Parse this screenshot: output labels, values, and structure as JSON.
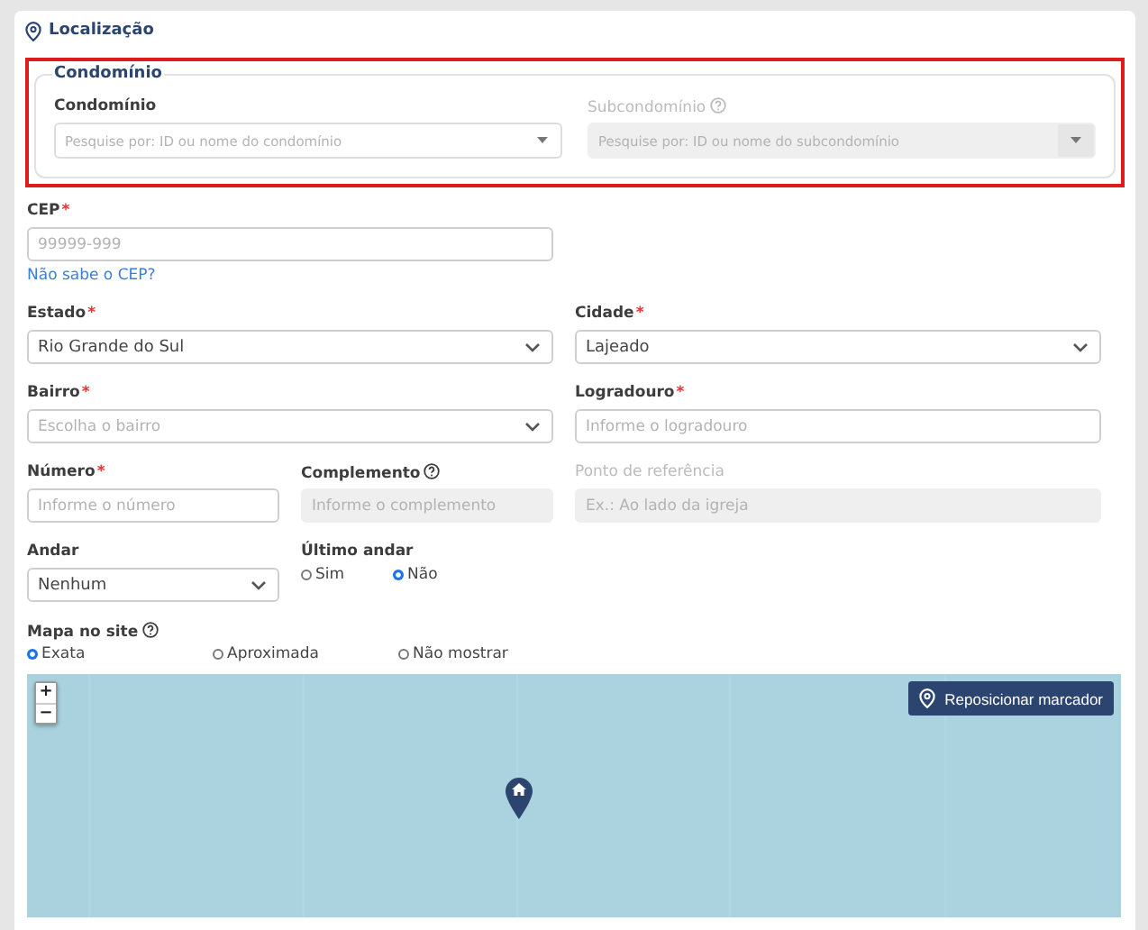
{
  "section": {
    "title": "Localização"
  },
  "condominio": {
    "highlighted": true,
    "legend": "Condomínio",
    "fields": [
      {
        "label": "Condomínio",
        "placeholder": "Pesquise por: ID ou nome do condomínio",
        "disabled": false
      },
      {
        "label": "Subcondomínio",
        "placeholder": "Pesquise por: ID ou nome do subcondomínio",
        "help": true,
        "disabled": true
      }
    ]
  },
  "rows": [
    {
      "kind": "wide",
      "fields": [
        {
          "kind": "input",
          "label": "CEP",
          "marker": "*",
          "placeholder": "99999-999",
          "link": "Não sabe o CEP?",
          "disabled": false,
          "label_dimmed": false
        }
      ]
    },
    {
      "kind": "wide",
      "fields": [
        {
          "kind": "select",
          "label": "Estado",
          "marker": "*",
          "value": "Rio Grande do Sul",
          "disabled": false,
          "label_dimmed": false
        },
        {
          "kind": "select",
          "label": "Cidade",
          "marker": "*",
          "value": "Lajeado",
          "disabled": false,
          "label_dimmed": false
        }
      ]
    },
    {
      "kind": "wide",
      "fields": [
        {
          "kind": "select",
          "label": "Bairro",
          "marker": "*",
          "placeholder": "Escolha o bairro",
          "disabled": false,
          "label_dimmed": false
        },
        {
          "kind": "input",
          "label": "Logradouro",
          "marker": "*",
          "placeholder": "Informe o logradouro",
          "disabled": false,
          "label_dimmed": false
        }
      ]
    },
    {
      "kind": "narrow",
      "fields": [
        {
          "kind": "input",
          "label": "Número",
          "marker": "*",
          "placeholder": "Informe o número",
          "disabled": false,
          "label_dimmed": false
        },
        {
          "kind": "input",
          "label": "Complemento",
          "placeholder": "Informe o complemento",
          "disabled": true,
          "label_dimmed": false,
          "help": true
        },
        {
          "kind": "input",
          "label": "Ponto de referência",
          "placeholder": "Ex.: Ao lado da igreja",
          "disabled": true,
          "label_dimmed": true
        }
      ]
    },
    {
      "kind": "narrow",
      "fields": [
        {
          "kind": "select",
          "label": "Andar",
          "value": "Nenhum",
          "disabled": false,
          "label_dimmed": false
        },
        {
          "kind": "radio",
          "label": "Último andar",
          "label_dimmed": false,
          "options": [
            {
              "label": "Sim",
              "selected": false
            },
            {
              "label": "Não",
              "selected": true
            }
          ]
        }
      ]
    }
  ],
  "map_mode": {
    "label": "Mapa no site",
    "help": true,
    "options": [
      {
        "label": "Exata",
        "selected": true
      },
      {
        "label": "Aproximada",
        "selected": false
      },
      {
        "label": "Não mostrar",
        "selected": false
      }
    ]
  },
  "map": {
    "zoom_in": "+",
    "zoom_out": "−",
    "button": "Reposicionar marcador"
  }
}
